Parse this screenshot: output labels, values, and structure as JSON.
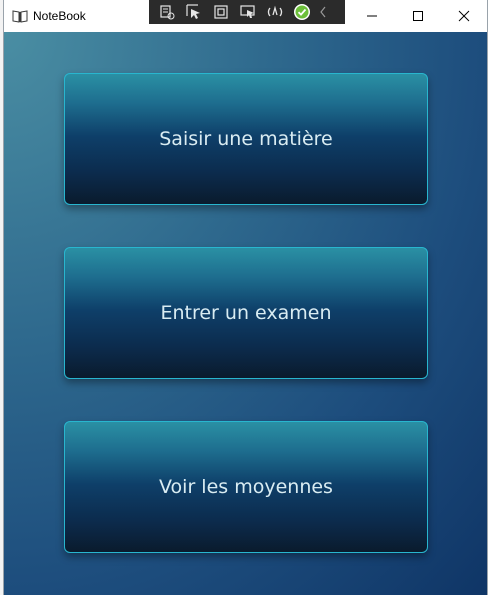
{
  "window": {
    "title": "NoteBook"
  },
  "debug_toolbar": {
    "icons": [
      "live-visual-tree-icon",
      "select-element-icon",
      "display-layout-adorners-icon",
      "track-focus-icon",
      "hot-reload-icon",
      "status-ok-icon",
      "collapse-icon"
    ],
    "status_color": "#6dbf3b"
  },
  "caption_buttons": {
    "icons": [
      "minimize-icon",
      "maximize-icon",
      "close-icon"
    ]
  },
  "menu": {
    "buttons": [
      {
        "label": "Saisir une matière"
      },
      {
        "label": "Entrer un examen"
      },
      {
        "label": "Voir les moyennes"
      }
    ]
  },
  "colors": {
    "background_top_left": "#4a8ea3",
    "background_bottom_right": "#0f3566",
    "button_border": "#28b6cf",
    "button_text": "#d9ecf2"
  }
}
